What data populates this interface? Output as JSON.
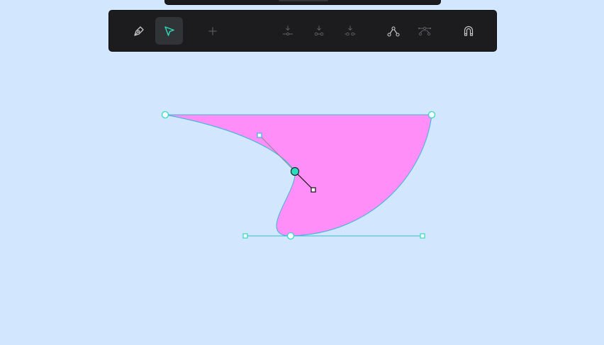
{
  "toolbar": {
    "tools": [
      {
        "name": "pen-tool",
        "icon": "pen-icon",
        "state": "enabled"
      },
      {
        "name": "select-tool",
        "icon": "cursor-icon",
        "state": "active"
      },
      {
        "name": "add-point-tool",
        "icon": "plus-icon",
        "state": "disabled"
      },
      {
        "name": "insert-node-tool",
        "icon": "insert-node-icon",
        "state": "disabled"
      },
      {
        "name": "insert-node-between-tool",
        "icon": "insert-node-between-icon",
        "state": "disabled"
      },
      {
        "name": "insert-node-split-tool",
        "icon": "insert-node-split-icon",
        "state": "disabled"
      },
      {
        "name": "curve-node-tool",
        "icon": "curve-node-icon",
        "state": "enabled"
      },
      {
        "name": "smooth-node-tool",
        "icon": "smooth-node-icon",
        "state": "disabled"
      },
      {
        "name": "snap-toggle",
        "icon": "magnet-icon",
        "state": "enabled"
      }
    ]
  },
  "colors": {
    "background": "#d2e7fe",
    "toolbar": "#1c1c1f",
    "accent": "#2ddbbd",
    "shape_fill": "#ff8ef8",
    "shape_stroke": "#35b9d8",
    "icon_enabled": "#c6c6c8",
    "icon_disabled": "#5c5c60"
  }
}
